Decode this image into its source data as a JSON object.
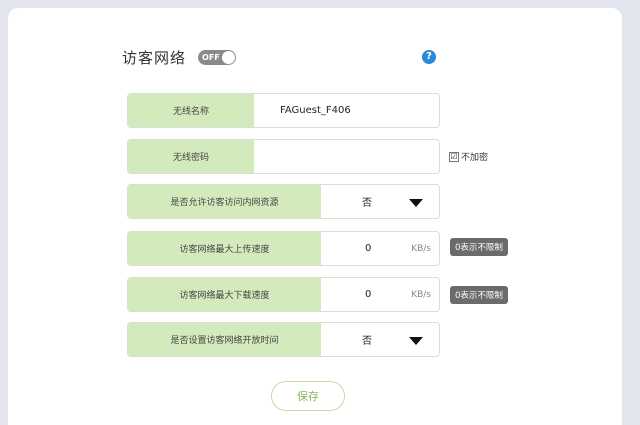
{
  "guest": {
    "title": "访客网络",
    "toggle_label": "OFF",
    "help_icon": "?"
  },
  "rows": {
    "ssid": {
      "label": "无线名称",
      "value": "FAGuest_F406"
    },
    "password": {
      "label": "无线密码",
      "value": ""
    },
    "intranet": {
      "label": "是否允许访客访问内网资源",
      "value": "否"
    },
    "upload": {
      "label": "访客网络最大上传速度",
      "value": "0",
      "unit": "KB/s"
    },
    "download": {
      "label": "访客网络最大下载速度",
      "value": "0",
      "unit": "KB/s"
    },
    "schedule": {
      "label": "是否设置访客网络开放时间",
      "value": "否"
    }
  },
  "no_encrypt": {
    "check_mark": "☑",
    "label": "不加密"
  },
  "hints": {
    "upload": "0表示不限制",
    "download": "0表示不限制"
  },
  "save_label": "保存",
  "colors": {
    "label_bg": "#d3ebbc",
    "accent": "#8ab65a",
    "help": "#2a8ad8",
    "hint_bg": "#6b6b6b"
  }
}
